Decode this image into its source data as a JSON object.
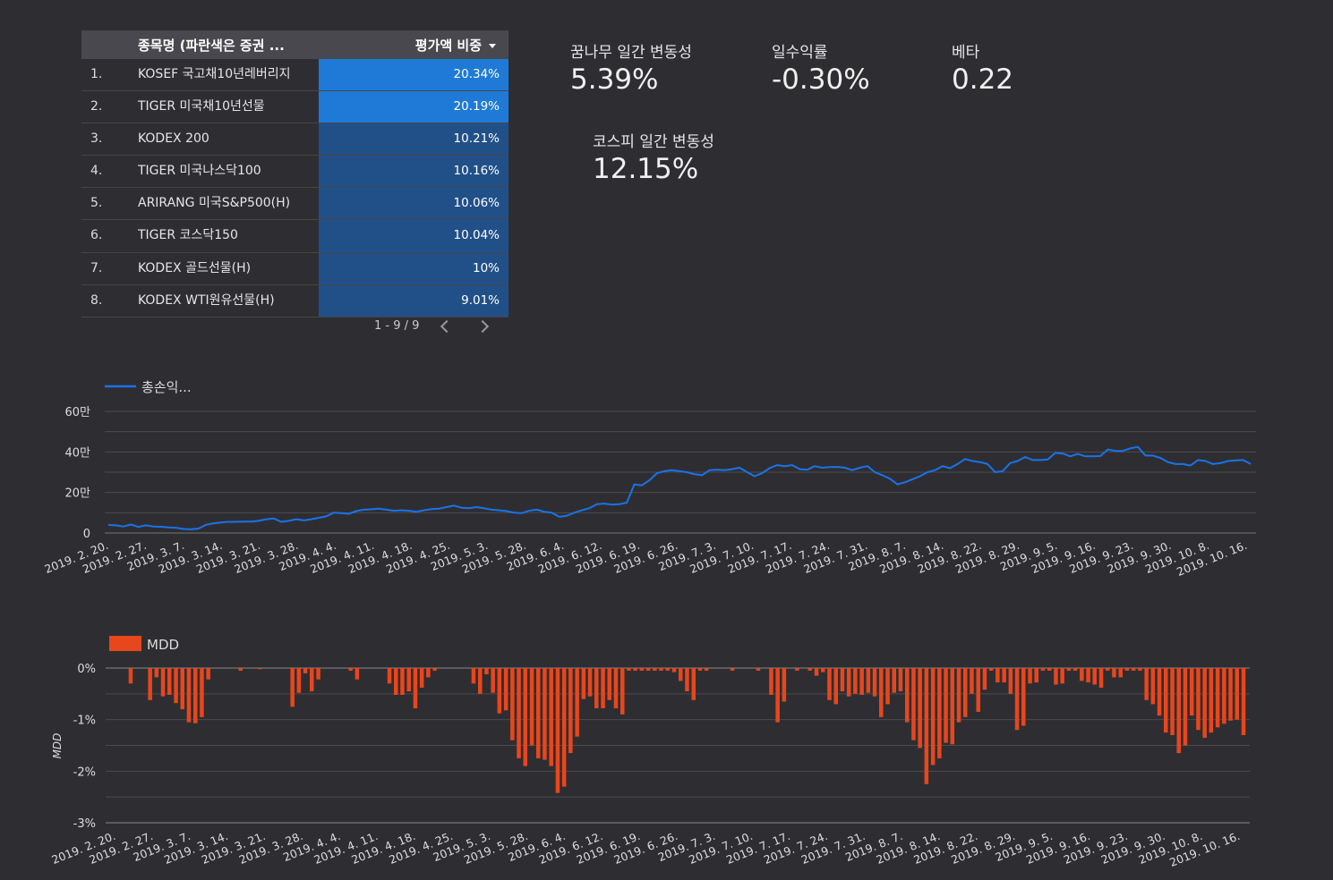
{
  "table": {
    "header_name": "종목명 (파란색은 증권 ...",
    "header_value": "평가액 비중",
    "rows": [
      {
        "num": "1.",
        "name": "KOSEF 국고채10년레버리지",
        "value": "20.34%",
        "pct": 20.34
      },
      {
        "num": "2.",
        "name": "TIGER 미국채10년선물",
        "value": "20.19%",
        "pct": 20.19
      },
      {
        "num": "3.",
        "name": "KODEX 200",
        "value": "10.21%",
        "pct": 10.21
      },
      {
        "num": "4.",
        "name": "TIGER 미국나스닥100",
        "value": "10.16%",
        "pct": 10.16
      },
      {
        "num": "5.",
        "name": "ARIRANG 미국S&P500(H)",
        "value": "10.06%",
        "pct": 10.06
      },
      {
        "num": "6.",
        "name": "TIGER 코스닥150",
        "value": "10.04%",
        "pct": 10.04
      },
      {
        "num": "7.",
        "name": "KODEX 골드선물(H)",
        "value": "10%",
        "pct": 10
      },
      {
        "num": "8.",
        "name": "KODEX WTI원유선물(H)",
        "value": "9.01%",
        "pct": 9.01
      }
    ],
    "pagination": "1 - 9 / 9",
    "colors": {
      "high": "#1e7ad6",
      "low": "#215089"
    }
  },
  "kpis": {
    "volatility": {
      "label": "꿈나무 일간 변동성",
      "value": "5.39%"
    },
    "daily_return": {
      "label": "일수익률",
      "value": "-0.30%"
    },
    "beta": {
      "label": "베타",
      "value": "0.22"
    },
    "kospi_volatility": {
      "label": "코스피 일간 변동성",
      "value": "12.15%"
    }
  },
  "chart_data": [
    {
      "type": "line",
      "legend": "총손익...",
      "color": "#1a73e8",
      "ylim": [
        0,
        600000
      ],
      "y_ticks": [
        "0",
        "20만",
        "40만",
        "60만"
      ],
      "x_tick_labels": [
        "2019. 2. 20.",
        "2019. 2. 27.",
        "2019. 3. 7.",
        "2019. 3. 14.",
        "2019. 3. 21.",
        "2019. 3. 28.",
        "2019. 4. 4.",
        "2019. 4. 11.",
        "2019. 4. 18.",
        "2019. 4. 25.",
        "2019. 5. 3.",
        "2019. 5. 28.",
        "2019. 6. 4.",
        "2019. 6. 12.",
        "2019. 6. 19.",
        "2019. 6. 26.",
        "2019. 7. 3.",
        "2019. 7. 10.",
        "2019. 7. 17.",
        "2019. 7. 24.",
        "2019. 7. 31.",
        "2019. 8. 7.",
        "2019. 8. 14.",
        "2019. 8. 22.",
        "2019. 8. 29.",
        "2019. 9. 5.",
        "2019. 9. 16.",
        "2019. 9. 23.",
        "2019. 9. 30.",
        "2019. 10. 8.",
        "2019. 10. 16."
      ],
      "values": [
        40000,
        38000,
        32000,
        42000,
        30000,
        38000,
        32000,
        31000,
        28000,
        26000,
        20000,
        18000,
        22000,
        40000,
        48000,
        52000,
        55000,
        55000,
        56000,
        56000,
        60000,
        68000,
        72000,
        55000,
        60000,
        68000,
        62000,
        68000,
        75000,
        82000,
        100000,
        98000,
        95000,
        108000,
        115000,
        117000,
        120000,
        115000,
        110000,
        112000,
        110000,
        105000,
        112000,
        118000,
        120000,
        128000,
        135000,
        125000,
        122000,
        128000,
        122000,
        115000,
        112000,
        108000,
        100000,
        98000,
        110000,
        115000,
        105000,
        100000,
        80000,
        85000,
        100000,
        112000,
        122000,
        142000,
        145000,
        140000,
        142000,
        150000,
        240000,
        235000,
        260000,
        295000,
        305000,
        310000,
        305000,
        300000,
        290000,
        285000,
        310000,
        312000,
        310000,
        315000,
        322000,
        300000,
        280000,
        295000,
        320000,
        335000,
        330000,
        335000,
        315000,
        312000,
        330000,
        322000,
        325000,
        326000,
        322000,
        310000,
        322000,
        330000,
        300000,
        285000,
        268000,
        240000,
        250000,
        265000,
        280000,
        300000,
        310000,
        330000,
        320000,
        340000,
        365000,
        355000,
        350000,
        340000,
        300000,
        305000,
        345000,
        355000,
        375000,
        360000,
        360000,
        362000,
        395000,
        392000,
        378000,
        390000,
        378000,
        378000,
        380000,
        412000,
        405000,
        405000,
        418000,
        425000,
        382000,
        382000,
        370000,
        350000,
        340000,
        340000,
        333000,
        360000,
        355000,
        340000,
        345000,
        355000,
        358000,
        360000,
        340000
      ]
    },
    {
      "type": "bar",
      "legend": "MDD",
      "ylabel": "MDD",
      "color": "#e8461c",
      "ylim": [
        -3,
        0
      ],
      "y_ticks": [
        "0%",
        "-1%",
        "-2%",
        "-3%"
      ],
      "x_tick_labels": [
        "2019. 2. 20.",
        "2019. 2. 27.",
        "2019. 3. 7.",
        "2019. 3. 14.",
        "2019. 3. 21.",
        "2019. 3. 28.",
        "2019. 4. 4.",
        "2019. 4. 11.",
        "2019. 4. 18.",
        "2019. 4. 25.",
        "2019. 5. 3.",
        "2019. 5. 28.",
        "2019. 6. 4.",
        "2019. 6. 12.",
        "2019. 6. 19.",
        "2019. 6. 26.",
        "2019. 7. 3.",
        "2019. 7. 10.",
        "2019. 7. 17.",
        "2019. 7. 24.",
        "2019. 7. 31.",
        "2019. 8. 7.",
        "2019. 8. 14.",
        "2019. 8. 22.",
        "2019. 8. 29.",
        "2019. 9. 5.",
        "2019. 9. 16.",
        "2019. 9. 23.",
        "2019. 9. 30.",
        "2019. 10. 8.",
        "2019. 10. 16."
      ],
      "values": [
        0,
        0,
        0,
        -0.3,
        0,
        0,
        -0.62,
        -0.18,
        -0.55,
        -0.52,
        -0.68,
        -0.8,
        -1.05,
        -1.07,
        -0.95,
        -0.22,
        0,
        0,
        0,
        0,
        -0.05,
        0,
        0,
        -0.02,
        0,
        0,
        0,
        0,
        -0.75,
        -0.48,
        -0.1,
        -0.45,
        -0.22,
        0,
        0,
        0,
        0,
        -0.05,
        -0.22,
        0,
        0,
        0,
        0,
        -0.3,
        -0.52,
        -0.52,
        -0.45,
        -0.78,
        -0.38,
        -0.18,
        -0.05,
        0,
        0,
        0,
        0,
        0,
        -0.3,
        -0.5,
        -0.12,
        -0.48,
        -0.88,
        -0.82,
        -1.4,
        -1.75,
        -1.9,
        -1.5,
        -1.75,
        -1.78,
        -1.9,
        -2.42,
        -2.3,
        -1.65,
        -1.33,
        -0.6,
        -0.55,
        -0.78,
        -0.78,
        -0.62,
        -0.78,
        -0.9,
        -0.05,
        -0.05,
        -0.05,
        -0.05,
        -0.05,
        -0.05,
        -0.05,
        -0.08,
        -0.25,
        -0.45,
        -0.62,
        -0.05,
        -0.05,
        0,
        0,
        0,
        -0.05,
        0,
        0,
        0,
        -0.05,
        0,
        -0.52,
        -1.05,
        -0.65,
        0,
        -0.05,
        0,
        -0.05,
        -0.15,
        -0.08,
        -0.62,
        -0.7,
        -0.45,
        -0.55,
        -0.5,
        -0.52,
        -0.48,
        -0.55,
        -0.95,
        -0.7,
        -0.48,
        -0.45,
        -1.05,
        -1.4,
        -1.55,
        -2.25,
        -1.88,
        -1.75,
        -1.45,
        -1.48,
        -1.05,
        -0.95,
        -0.5,
        -0.85,
        -0.42,
        -0.05,
        -0.28,
        -0.28,
        -0.5,
        -1.2,
        -1.12,
        -0.3,
        -0.28,
        -0.05,
        -0.05,
        -0.32,
        -0.3,
        -0.05,
        -0.05,
        -0.25,
        -0.28,
        -0.32,
        -0.38,
        -0.05,
        -0.18,
        -0.18,
        -0.05,
        -0.05,
        -0.05,
        -0.62,
        -0.7,
        -0.92,
        -1.25,
        -1.3,
        -1.65,
        -1.5,
        -0.92,
        -1.2,
        -1.35,
        -1.25,
        -1.15,
        -1.08,
        -1.02,
        -1.0,
        -1.3
      ]
    }
  ]
}
